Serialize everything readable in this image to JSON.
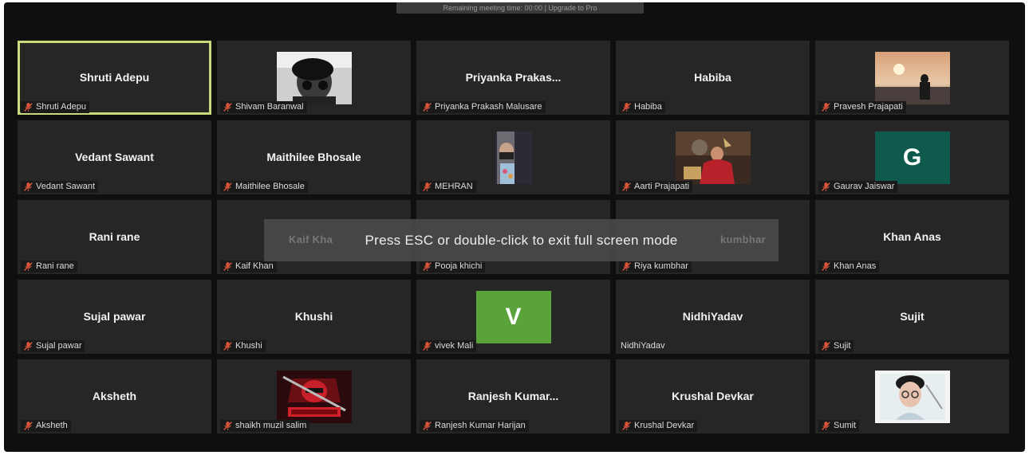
{
  "banner": {
    "text": "Remaining meeting time: 00:00 | Upgrade to Pro"
  },
  "toast": {
    "text": "Press ESC or double-click to exit full screen mode"
  },
  "colors": {
    "active_border": "#c8da7a",
    "muted_mic": "#d8553a",
    "avatar_g": "#0e5a4c",
    "avatar_v": "#5aa23a"
  },
  "participants": [
    {
      "display": "Shruti Adepu",
      "label": "Shruti Adepu",
      "active": true
    },
    {
      "display": "",
      "label": "Shivam Baranwal",
      "media": "photo-portrait-bw"
    },
    {
      "display": "Priyanka  Prakas...",
      "label": "Priyanka Prakash Malusare"
    },
    {
      "display": "Habiba",
      "label": "Habiba"
    },
    {
      "display": "",
      "label": "Pravesh Prajapati",
      "media": "photo-sunset"
    },
    {
      "display": "Vedant Sawant",
      "label": "Vedant Sawant"
    },
    {
      "display": "Maithilee Bhosale",
      "label": "Maithilee Bhosale"
    },
    {
      "display": "",
      "label": "MEHRAN",
      "media": "photo-selfie-mask"
    },
    {
      "display": "",
      "label": "Aarti Prajapati",
      "media": "photo-painting"
    },
    {
      "display": "",
      "label": "Gaurav Jaiswar",
      "avatar": "G"
    },
    {
      "display": "Rani rane",
      "label": "Rani rane"
    },
    {
      "display": "Kaif Kha",
      "label": "Kaif Khan"
    },
    {
      "display": "",
      "label": "Pooja khichi"
    },
    {
      "display": "kumbhar",
      "label": "Riya kumbhar"
    },
    {
      "display": "Khan Anas",
      "label": "Khan Anas"
    },
    {
      "display": "Sujal pawar",
      "label": "Sujal pawar"
    },
    {
      "display": "Khushi",
      "label": "Khushi"
    },
    {
      "display": "",
      "label": "vivek Mali",
      "avatar": "V"
    },
    {
      "display": "NidhiYadav",
      "label": "NidhiYadav",
      "unmuted": true
    },
    {
      "display": "Sujit",
      "label": "Sujit"
    },
    {
      "display": "Aksheth",
      "label": "Aksheth"
    },
    {
      "display": "",
      "label": "shaikh muzil salim",
      "media": "photo-gaming-logo"
    },
    {
      "display": "Ranjesh  Kumar...",
      "label": "Ranjesh Kumar Harijan"
    },
    {
      "display": "Krushal Devkar",
      "label": "Krushal Devkar"
    },
    {
      "display": "",
      "label": "Sumit",
      "media": "photo-selfie-glasses"
    }
  ]
}
